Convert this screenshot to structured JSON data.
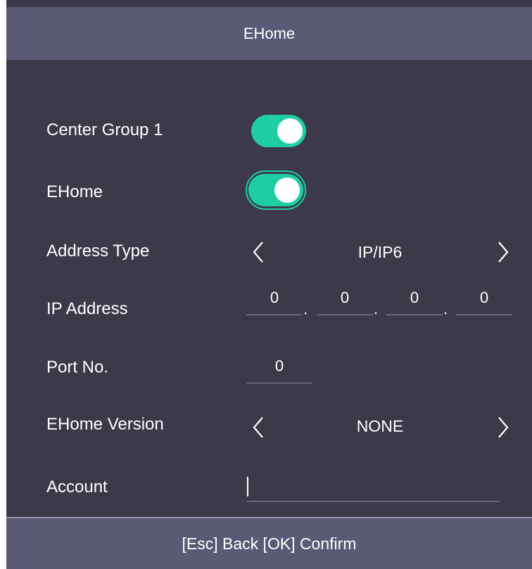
{
  "header": {
    "title": "EHome"
  },
  "rows": {
    "center_group": {
      "label": "Center Group 1",
      "enabled": true
    },
    "ehome": {
      "label": "EHome",
      "enabled": true
    },
    "address_type": {
      "label": "Address Type",
      "value": "IP/IP6"
    },
    "ip_address": {
      "label": "IP Address",
      "segments": [
        "0",
        "0",
        "0",
        "0"
      ],
      "separator": "."
    },
    "port": {
      "label": "Port No.",
      "value": "0"
    },
    "ehome_version": {
      "label": "EHome Version",
      "value": "NONE"
    },
    "account": {
      "label": "Account",
      "value": ""
    }
  },
  "footer": {
    "hint": "[Esc] Back [OK] Confirm"
  },
  "colors": {
    "background": "#3c3a48",
    "bar": "#5b5a76",
    "accent": "#1fcda5",
    "text": "#ffffff"
  },
  "icons": {
    "prev": "chevron-left-icon",
    "next": "chevron-right-icon"
  }
}
